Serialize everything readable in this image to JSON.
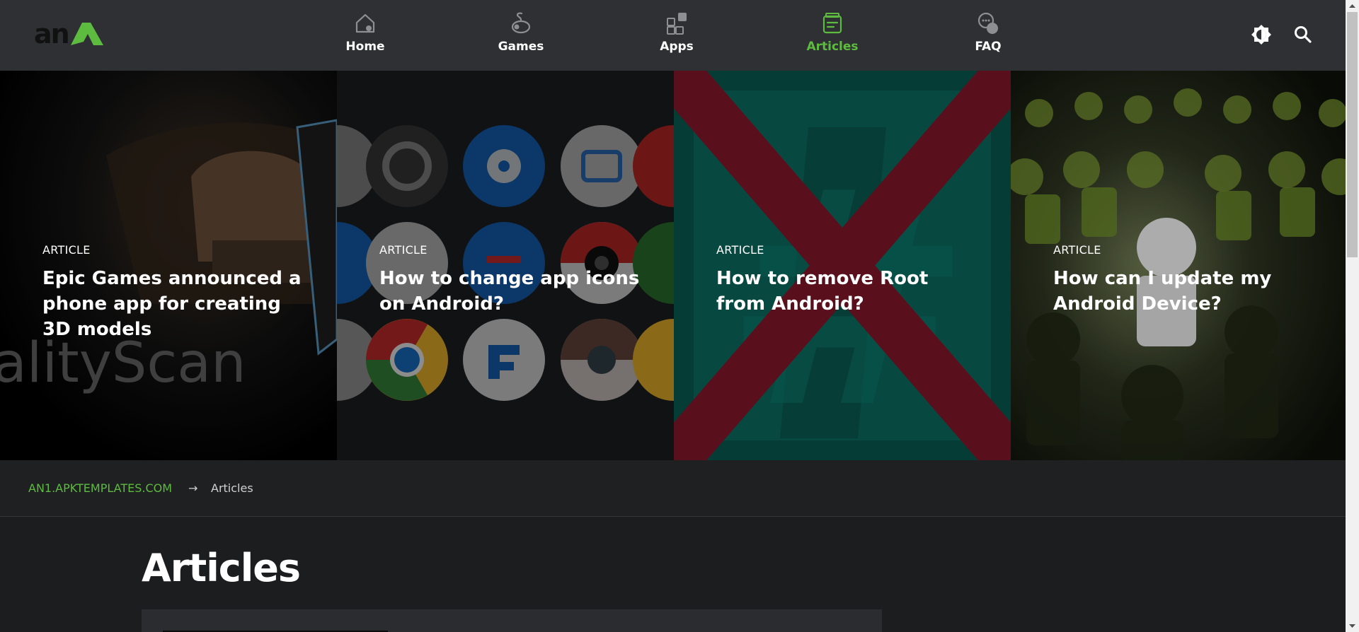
{
  "header": {
    "logo_text": "an",
    "nav": [
      {
        "label": "Home",
        "icon": "home-icon"
      },
      {
        "label": "Games",
        "icon": "gamepad-icon"
      },
      {
        "label": "Apps",
        "icon": "apps-grid-icon"
      },
      {
        "label": "Articles",
        "icon": "articles-icon",
        "active": true
      },
      {
        "label": "FAQ",
        "icon": "chat-bubbles-icon"
      }
    ],
    "actions": [
      "theme-toggle-icon",
      "search-icon"
    ]
  },
  "hero": {
    "cards": [
      {
        "kicker": "ARTICLE",
        "title": "Epic Games announced a phone app for creating 3D models",
        "image_text": "alityScan"
      },
      {
        "kicker": "ARTICLE",
        "title": "How to change app icons on Android?"
      },
      {
        "kicker": "ARTICLE",
        "title": "How to remove Root from Android?"
      },
      {
        "kicker": "ARTICLE",
        "title": "How can I update my Android Device?"
      }
    ]
  },
  "breadcrumb": {
    "home": "AN1.APKTEMPLATES.COM",
    "separator": "→",
    "current": "Articles"
  },
  "main": {
    "title": "Articles"
  },
  "colors": {
    "header_bg": "#2e3033",
    "page_bg": "#1c1d1f",
    "accent": "#5dbb3f",
    "text": "#ffffff"
  }
}
